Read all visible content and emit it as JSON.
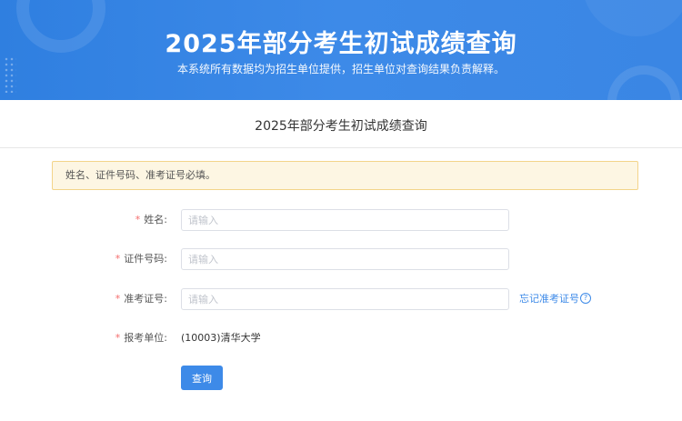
{
  "banner": {
    "title": "2025年部分考生初试成绩查询",
    "subtitle": "本系统所有数据均为招生单位提供，招生单位对查询结果负责解释。"
  },
  "section": {
    "title": "2025年部分考生初试成绩查询"
  },
  "alert": {
    "text": "姓名、证件号码、准考证号必填。"
  },
  "form": {
    "required_mark": "*",
    "name": {
      "label": "姓名:",
      "placeholder": "请输入",
      "value": ""
    },
    "id_number": {
      "label": "证件号码:",
      "placeholder": "请输入",
      "value": ""
    },
    "exam_number": {
      "label": "准考证号:",
      "placeholder": "请输入",
      "value": ""
    },
    "forgot_link": "忘记准考证号",
    "forgot_icon": "question-circle-icon",
    "unit": {
      "label": "报考单位:",
      "value": "(10003)清华大学"
    },
    "submit_label": "查询"
  },
  "colors": {
    "primary": "#3d8ae8",
    "alert_bg": "#fdf6e3",
    "alert_border": "#f3d48a",
    "required": "#f56c6c"
  }
}
